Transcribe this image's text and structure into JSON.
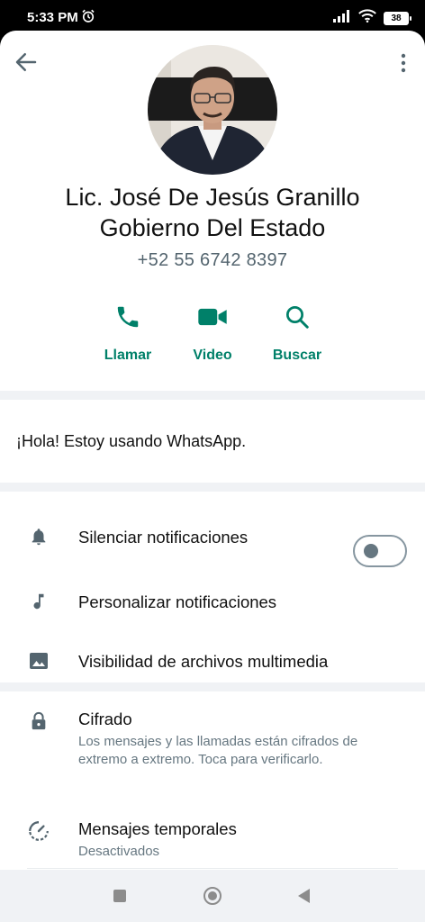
{
  "status_bar": {
    "time": "5:33 PM",
    "battery": "38"
  },
  "header": {
    "back_icon": "arrow-left-icon",
    "more_icon": "more-vertical-icon"
  },
  "contact": {
    "name": "Lic. José De Jesús Granillo Gobierno Del Estado",
    "phone": "+52 55 6742 8397"
  },
  "actions": [
    {
      "label": "Llamar",
      "icon": "phone-icon"
    },
    {
      "label": "Video",
      "icon": "video-icon"
    },
    {
      "label": "Buscar",
      "icon": "search-icon"
    }
  ],
  "about": {
    "text": "¡Hola! Estoy usando WhatsApp."
  },
  "notifications": {
    "mute_label": "Silenciar notificaciones",
    "mute_on": false,
    "custom_label": "Personalizar notificaciones",
    "media_label": "Visibilidad de archivos multimedia"
  },
  "security": {
    "encryption_title": "Cifrado",
    "encryption_sub": "Los mensajes y las llamadas están cifrados de extremo a extremo. Toca para verificarlo.",
    "disappearing_title": "Mensajes temporales",
    "disappearing_sub": "Desactivados"
  },
  "colors": {
    "accent": "#008069",
    "background": "#f0f2f5",
    "icon_gray": "#54656f"
  }
}
